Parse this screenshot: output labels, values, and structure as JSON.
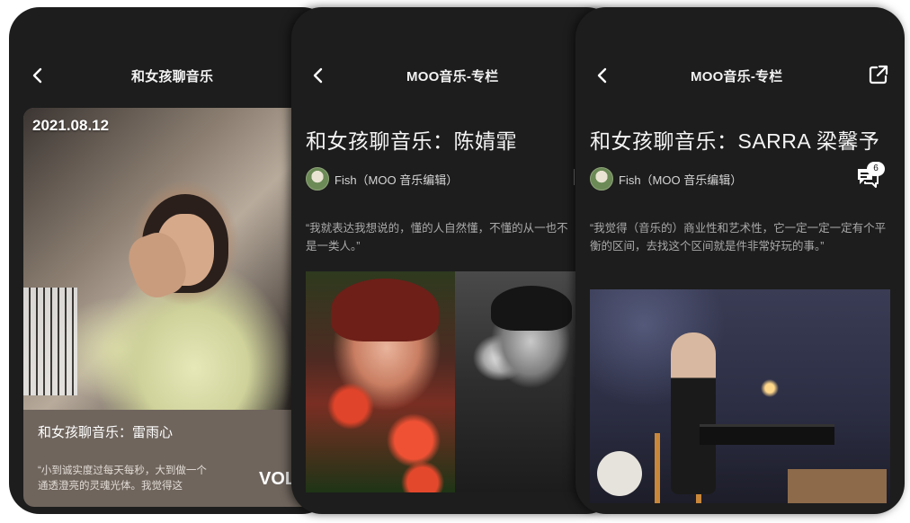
{
  "screens": [
    {
      "nav_title": "和女孩聊音乐",
      "card": {
        "date": "2021.08.12",
        "title": "和女孩聊音乐：雷雨心",
        "quote": "“小到诚实度过每天每秒，大到做一个通透澄亮的灵魂光体。我觉得这",
        "brand": "VOL"
      }
    },
    {
      "nav_title": "MOO音乐-专栏",
      "title": "和女孩聊音乐：陈婧霏",
      "author": "Fish（MOO 音乐编辑）",
      "quote": "“我就表达我想说的，懂的人自然懂，不懂的从一也不是一类人。”"
    },
    {
      "nav_title": "MOO音乐-专栏",
      "title": "和女孩聊音乐：SARRA 梁馨予",
      "author": "Fish（MOO 音乐编辑）",
      "comment_count": "6",
      "quote": "“我觉得（音乐的）商业性和艺术性，它一定一定一定有个平衡的区间，去找这个区间就是件非常好玩的事。”"
    }
  ],
  "icons": {
    "back": "chevron-left-icon",
    "share": "share-icon",
    "comment": "comment-icon"
  },
  "colors": {
    "screen_bg": "#1d1d1d",
    "card_bg": "#6f655d",
    "quote_text": "#a9a9a9"
  }
}
